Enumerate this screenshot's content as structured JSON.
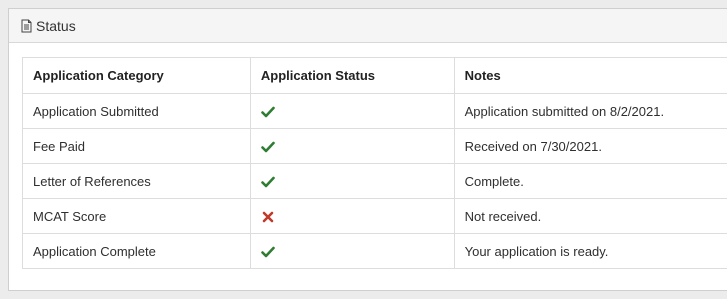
{
  "panel": {
    "title": "Status",
    "title_icon": "document-icon"
  },
  "table": {
    "headers": [
      "Application Category",
      "Application Status",
      "Notes"
    ],
    "rows": [
      {
        "category": "Application Submitted",
        "status": "check",
        "notes": "Application submitted on 8/2/2021."
      },
      {
        "category": "Fee Paid",
        "status": "check",
        "notes": "Received on 7/30/2021."
      },
      {
        "category": "Letter of References",
        "status": "check",
        "notes": "Complete."
      },
      {
        "category": "MCAT Score",
        "status": "cross",
        "notes": "Not received."
      },
      {
        "category": "Application Complete",
        "status": "check",
        "notes": "Your application is ready."
      }
    ]
  },
  "colors": {
    "check": "#2e7d32",
    "cross": "#c0392b"
  }
}
